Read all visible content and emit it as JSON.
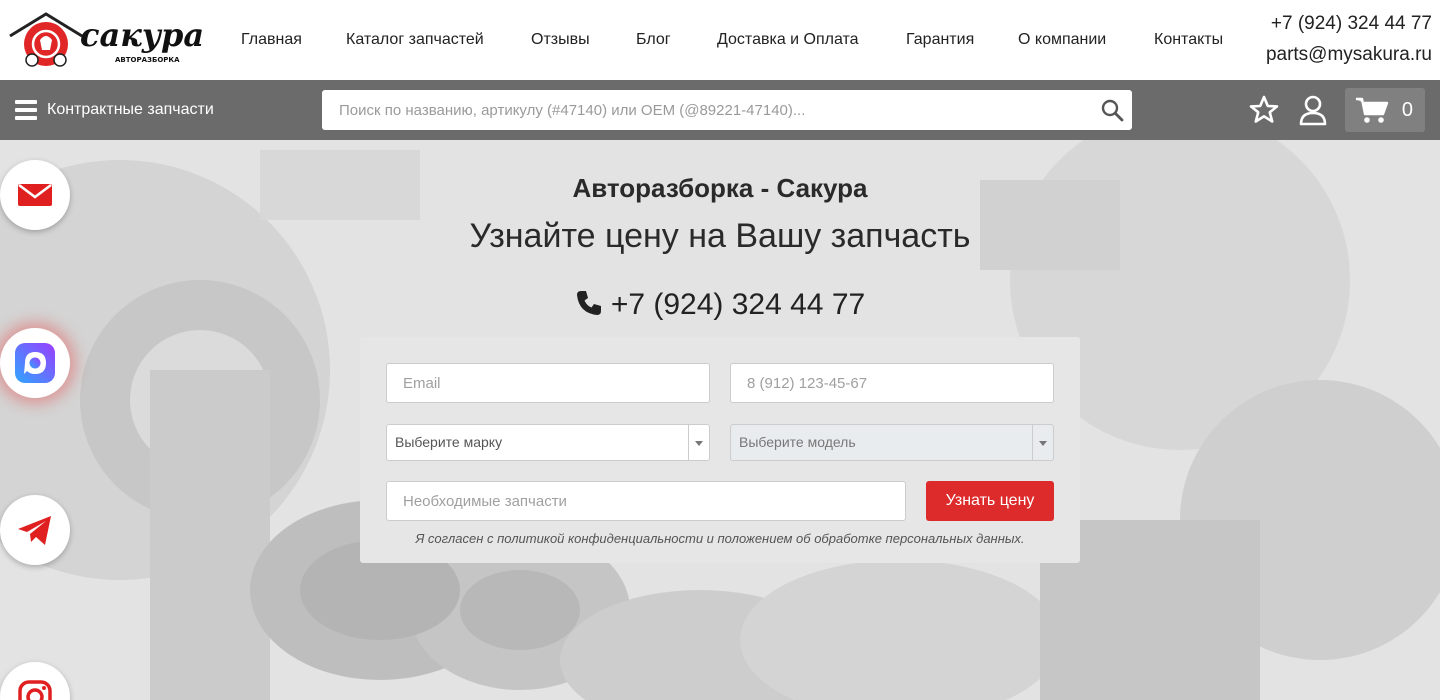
{
  "logo": {
    "text": "сакура",
    "subtitle": "АВТОРАЗБОРКА"
  },
  "nav": [
    {
      "label": "Главная"
    },
    {
      "label": "Каталог запчастей"
    },
    {
      "label": "Отзывы"
    },
    {
      "label": "Блог"
    },
    {
      "label": "Доставка и Оплата"
    },
    {
      "label": "Гарантия"
    },
    {
      "label": "О компании"
    },
    {
      "label": "Контакты"
    }
  ],
  "contacts": {
    "phone": "+7 (924) 324 44 77",
    "email": "parts@mysakura.ru"
  },
  "toolbar": {
    "menu_label": "Контрактные запчасти",
    "search_placeholder": "Поиск по названию, артикулу (#47140) или OEM (@89221-47140)...",
    "cart_count": "0"
  },
  "hero": {
    "title": "Авторазборка - Сакура",
    "subtitle": "Узнайте цену на Вашу запчасть",
    "phone": "+7 (924) 324 44 77"
  },
  "form": {
    "email_placeholder": "Email",
    "phone_placeholder": "8 (912) 123-45-67",
    "brand_select": "Выберите марку",
    "model_select": "Выберите модель",
    "parts_placeholder": "Необходимые запчасти",
    "submit_label": "Узнать цену",
    "consent": "Я согласен с политикой конфиденциальности и положением об обработке персональных данных."
  },
  "colors": {
    "accent": "#dd2a2a",
    "toolbar": "#6b6b6b",
    "cart": "#808080"
  },
  "icons": [
    "search-icon",
    "star-icon",
    "user-icon",
    "cart-icon",
    "phone-icon",
    "mail-icon",
    "max-icon",
    "telegram-icon",
    "instagram-icon"
  ]
}
